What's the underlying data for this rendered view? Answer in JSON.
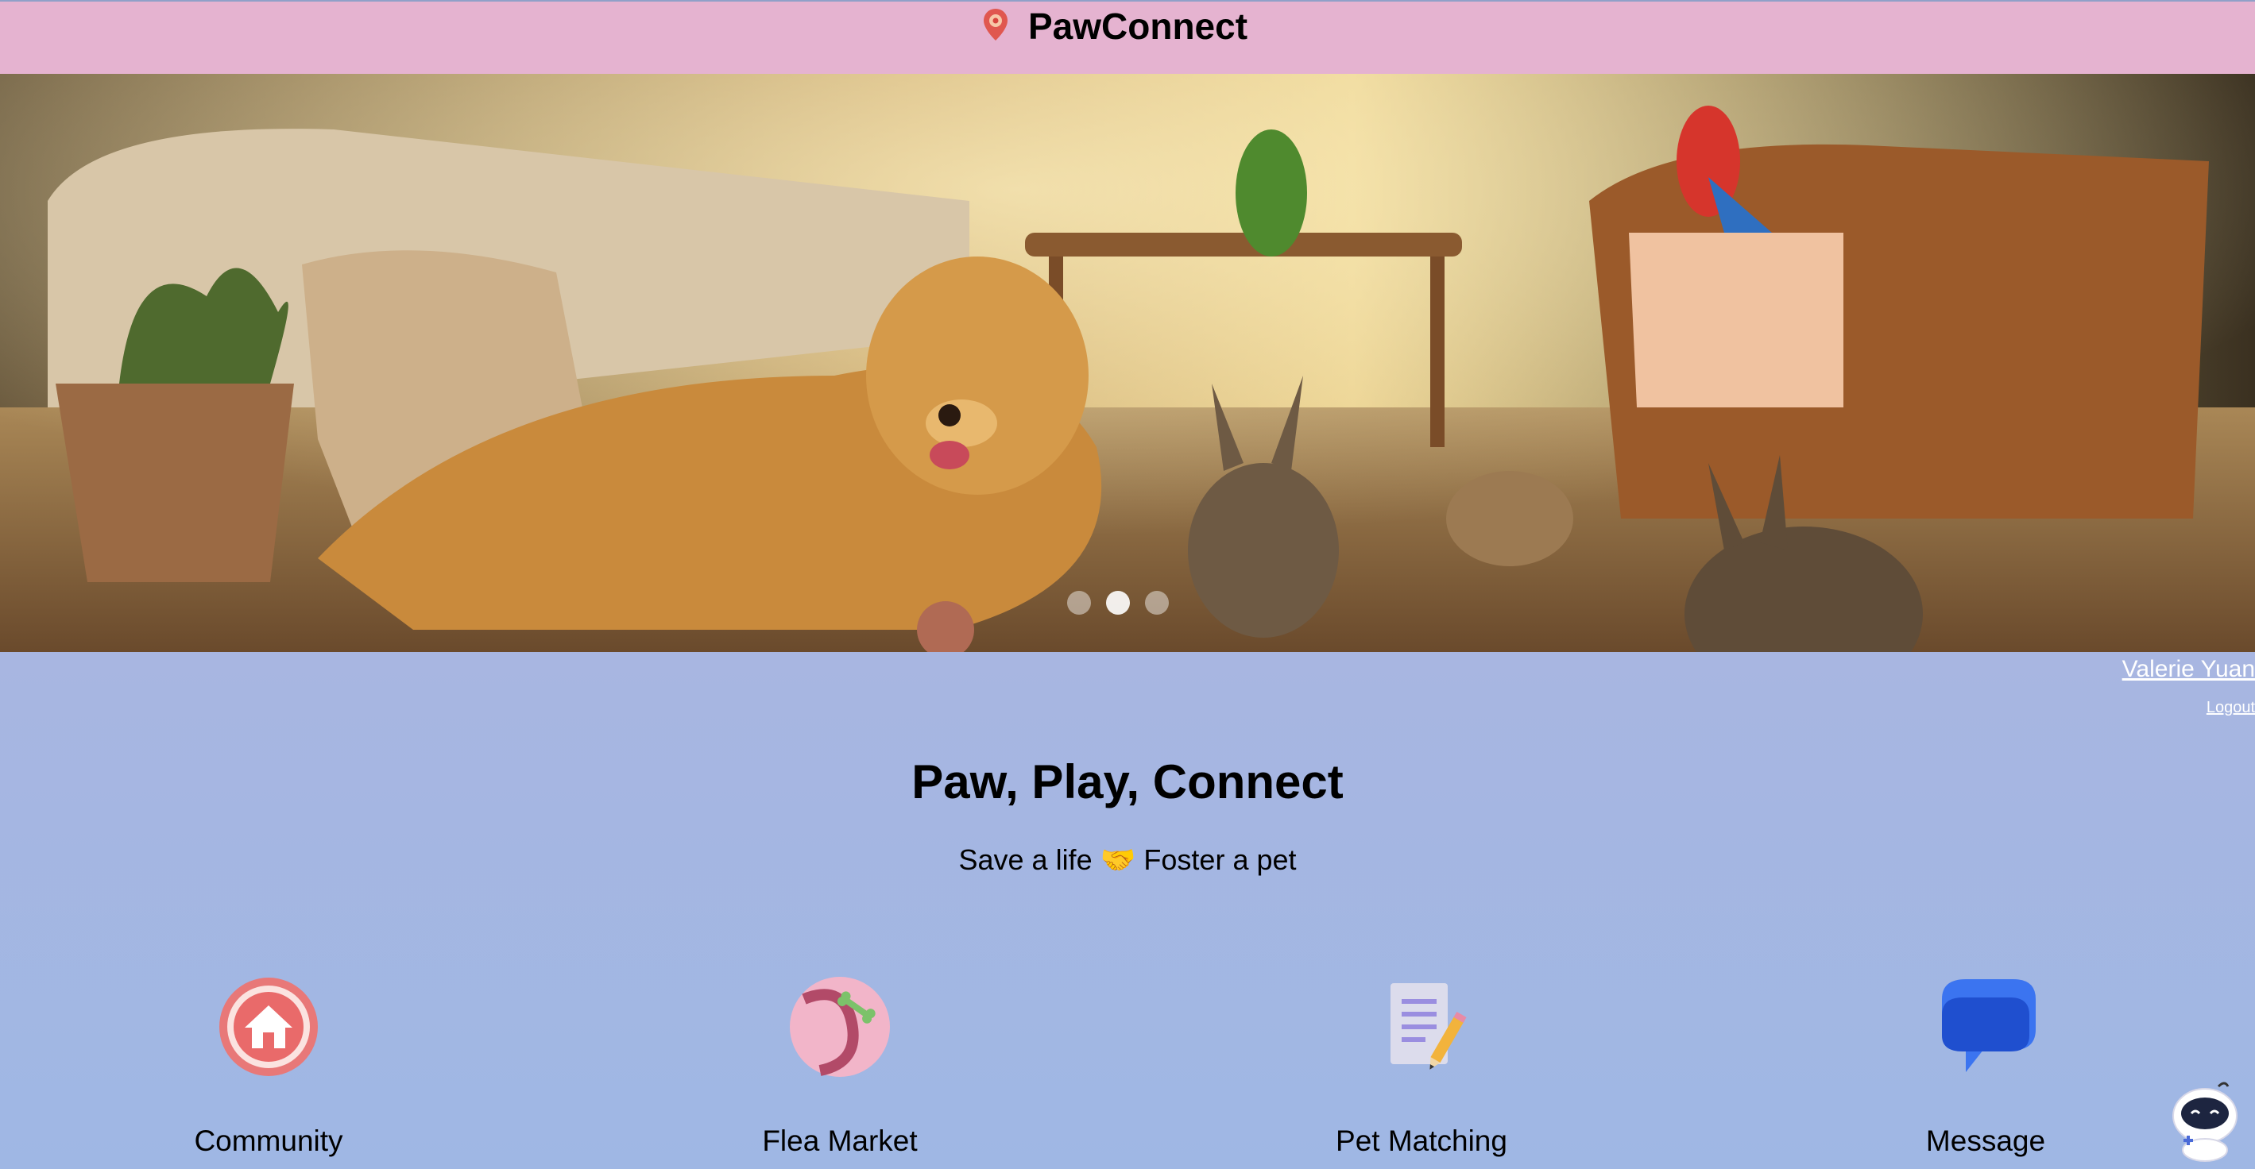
{
  "header": {
    "title": "PawConnect",
    "logo_icon": "map-pin-icon"
  },
  "hero": {
    "image_description_icon": "hero-photo-pets-living-room",
    "slides_count": 3,
    "active_slide": 2
  },
  "user": {
    "name": "Valerie Yuan",
    "logout_label": "Logout"
  },
  "main": {
    "headline": "Paw, Play, Connect",
    "tagline": "Save a life 🤝 Foster a pet"
  },
  "features": [
    {
      "label": "Community",
      "icon": "house-icon"
    },
    {
      "label": "Flea Market",
      "icon": "ball-bone-icon"
    },
    {
      "label": "Pet Matching",
      "icon": "notepad-pencil-icon"
    },
    {
      "label": "Message",
      "icon": "chat-bubble-icon"
    }
  ],
  "assistant": {
    "icon": "robot-assistant-icon"
  },
  "colors": {
    "topbar": "#e5b3d0",
    "background_top": "#bcb4dc",
    "background_bottom": "#9fb7e4",
    "link": "#ffffff"
  }
}
